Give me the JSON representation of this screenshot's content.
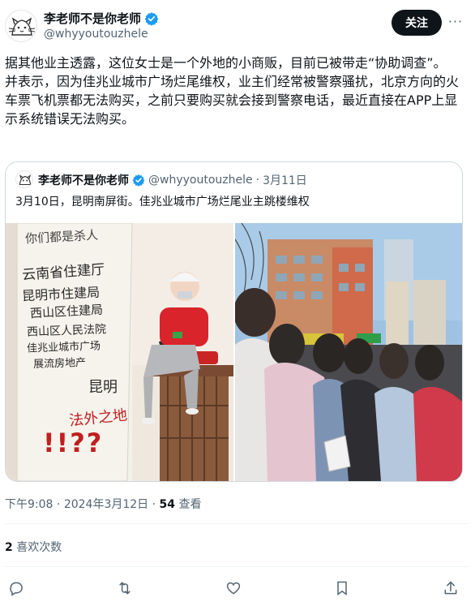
{
  "author": {
    "display_name": "李老师不是你老师",
    "handle": "@whyyoutouzhele"
  },
  "follow_label": "关注",
  "more_label": "···",
  "tweet": {
    "paragraph_1": "据其他业主透露，这位女士是一个外地的小商贩，目前已被带走“协助调查”。",
    "paragraph_2": "并表示，因为佳兆业城市广场烂尾维权，业主们经常被警察骚扰，北京方向的火车票飞机票都无法购买，之前只要购买就会接到警察电话，最近直接在APP上显示系统错误无法购买。"
  },
  "quote": {
    "display_name": "李老师不是你老师",
    "handle": "@whyyoutouzhele",
    "separator": "·",
    "date": "3月11日",
    "text": "3月10日，昆明南屏街。佳兆业城市广场烂尾业主跳楼维权",
    "banner_text": {
      "top": "你们都是杀人",
      "lines": [
        "云南省住建厅",
        "昆明市住建局",
        "西山区住建局",
        "西山区人民法院",
        "佳兆业城市广场",
        "展流房地产"
      ],
      "kunming": "昆明",
      "bottom": "法外之地",
      "marks": "!!??"
    }
  },
  "meta": {
    "time": "下午9:08",
    "dot1": "·",
    "date": "2024年3月12日",
    "dot2": "·",
    "views": "54",
    "views_label": "查看"
  },
  "likes": {
    "count": "2",
    "label": "喜欢次数"
  },
  "colors": {
    "text": "#0f1419",
    "muted": "#536471",
    "border": "#cfd9de",
    "verified": "#1d9bf0",
    "banner_red": "#c02020"
  },
  "icons": [
    "reply-icon",
    "retweet-icon",
    "like-icon",
    "bookmark-icon",
    "share-icon",
    "verified-badge-icon"
  ]
}
